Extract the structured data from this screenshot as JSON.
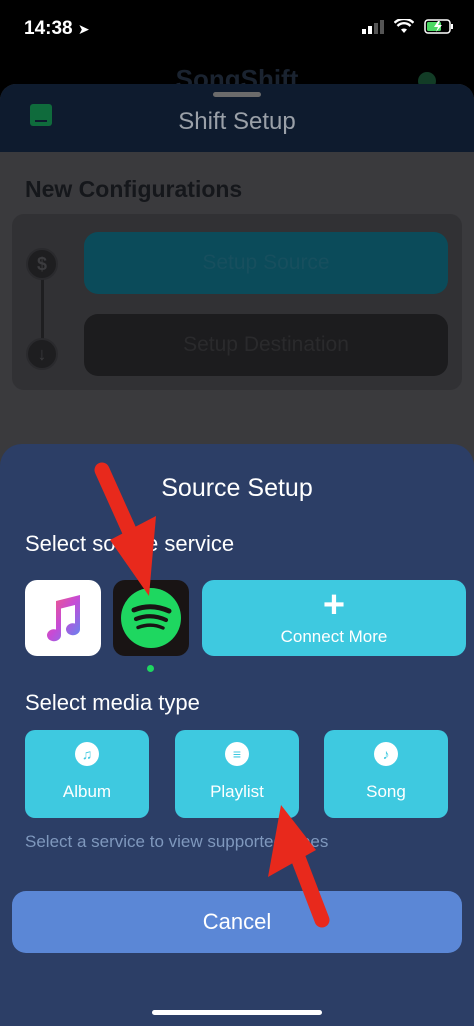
{
  "status_bar": {
    "time": "14:38"
  },
  "background_title": "SongShift",
  "setup": {
    "title": "Shift Setup",
    "section_title": "New Configurations",
    "source_button": "Setup Source",
    "destination_button": "Setup Destination"
  },
  "source_sheet": {
    "title": "Source Setup",
    "service_label": "Select source service",
    "services": [
      {
        "name": "apple-music-icon"
      },
      {
        "name": "spotify-icon",
        "selected": true
      }
    ],
    "connect_more": "Connect More",
    "media_label": "Select media type",
    "media_types": [
      {
        "label": "Album",
        "icon": "music-note-icon"
      },
      {
        "label": "Playlist",
        "icon": "playlist-icon"
      },
      {
        "label": "Song",
        "icon": "music-note-icon"
      }
    ],
    "hint": "Select a service to view supported types",
    "cancel": "Cancel"
  },
  "colors": {
    "accent": "#3ec9e0",
    "sheet_bg": "#2c3e66",
    "cancel": "#5b87d6",
    "spotify_green": "#1ed760",
    "annotation_arrow": "#e8291c"
  }
}
